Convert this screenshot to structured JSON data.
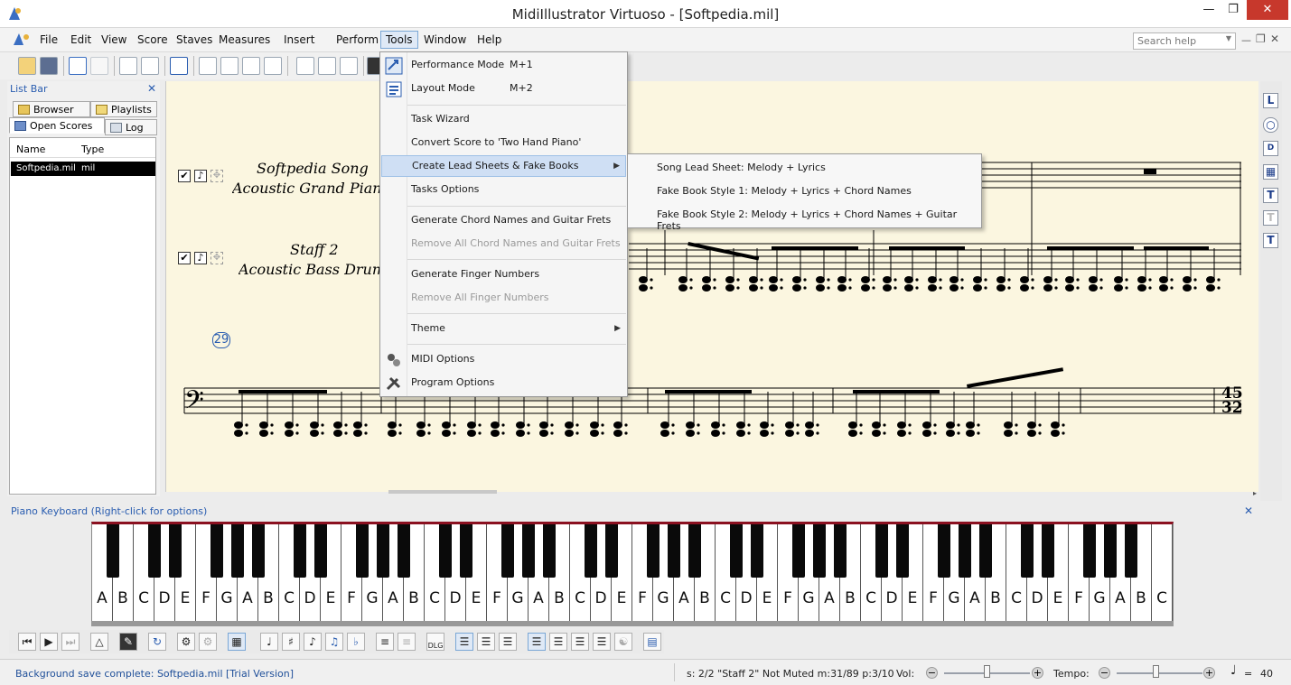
{
  "window": {
    "title": "MidiIllustrator Virtuoso - [Softpedia.mil]"
  },
  "menubar": {
    "items": [
      "File",
      "Edit",
      "View",
      "Score",
      "Staves",
      "Measures",
      "Insert",
      "Perform",
      "Tools",
      "Window",
      "Help"
    ],
    "search_placeholder": "Search help"
  },
  "listbar": {
    "title": "List Bar",
    "tabs": [
      "Browser",
      "Playlists",
      "Open Scores",
      "Log"
    ],
    "columns": [
      "Name",
      "Type"
    ],
    "rows": [
      {
        "name": "Softpedia.mil",
        "type": "mil"
      }
    ]
  },
  "score": {
    "staff1_line1": "Softpedia Song",
    "staff1_line2": "Acoustic Grand Piano",
    "staff2_line1": "Staff 2",
    "staff2_line2": "Acoustic Bass Drum",
    "measure_number": "29",
    "time_sig_top": "45",
    "time_sig_bottom": "32"
  },
  "tools_menu": {
    "items": [
      {
        "label": "Performance Mode",
        "shortcut": "M+1",
        "icon": "performance-icon"
      },
      {
        "label": "Layout Mode",
        "shortcut": "M+2",
        "icon": "layout-icon"
      },
      {
        "label": "Task Wizard"
      },
      {
        "label": "Convert Score to 'Two Hand Piano'"
      },
      {
        "label": "Create Lead Sheets & Fake Books",
        "submenu": true
      },
      {
        "label": "Tasks Options"
      },
      {
        "label": "Generate Chord Names and Guitar Frets"
      },
      {
        "label": "Remove All Chord Names and Guitar Frets",
        "disabled": true
      },
      {
        "label": "Generate Finger Numbers"
      },
      {
        "label": "Remove All Finger Numbers",
        "disabled": true
      },
      {
        "label": "Theme",
        "submenu": true
      },
      {
        "label": "MIDI Options",
        "icon": "midi-options-icon"
      },
      {
        "label": "Program Options",
        "icon": "program-options-icon"
      }
    ]
  },
  "submenu": {
    "items": [
      "Song Lead Sheet:  Melody + Lyrics",
      "Fake Book Style 1: Melody + Lyrics + Chord Names",
      "Fake Book Style 2: Melody + Lyrics + Chord Names + Guitar Frets"
    ]
  },
  "piano": {
    "title": "Piano Keyboard (Right-click for options)",
    "white_keys": [
      "A",
      "B",
      "C",
      "D",
      "E",
      "F",
      "G",
      "A",
      "B",
      "C",
      "D",
      "E",
      "F",
      "G",
      "A",
      "B",
      "C",
      "D",
      "E",
      "F",
      "G",
      "A",
      "B",
      "C",
      "D",
      "E",
      "F",
      "G",
      "A",
      "B",
      "C",
      "D",
      "E",
      "F",
      "G",
      "A",
      "B",
      "C",
      "D",
      "E",
      "F",
      "G",
      "A",
      "B",
      "C",
      "D",
      "E",
      "F",
      "G",
      "A",
      "B",
      "C"
    ]
  },
  "bottom_toolbar": {
    "dlg_label": "DLG"
  },
  "status": {
    "left": "Background save complete: Softpedia.mil  [Trial Version]",
    "info": "s: 2/2 \"Staff 2\" Not Muted  m:31/89  p:3/10",
    "vol_label": "Vol:",
    "tempo_label": "Tempo:",
    "tempo_value": "40",
    "vol_level": 0.5,
    "tempo_level": 0.45
  },
  "colors": {
    "accent": "#2a5db0",
    "parchment": "#fbf6e0",
    "menu_highlight": "#cfdff4",
    "keyboard_top": "#8b1020"
  }
}
